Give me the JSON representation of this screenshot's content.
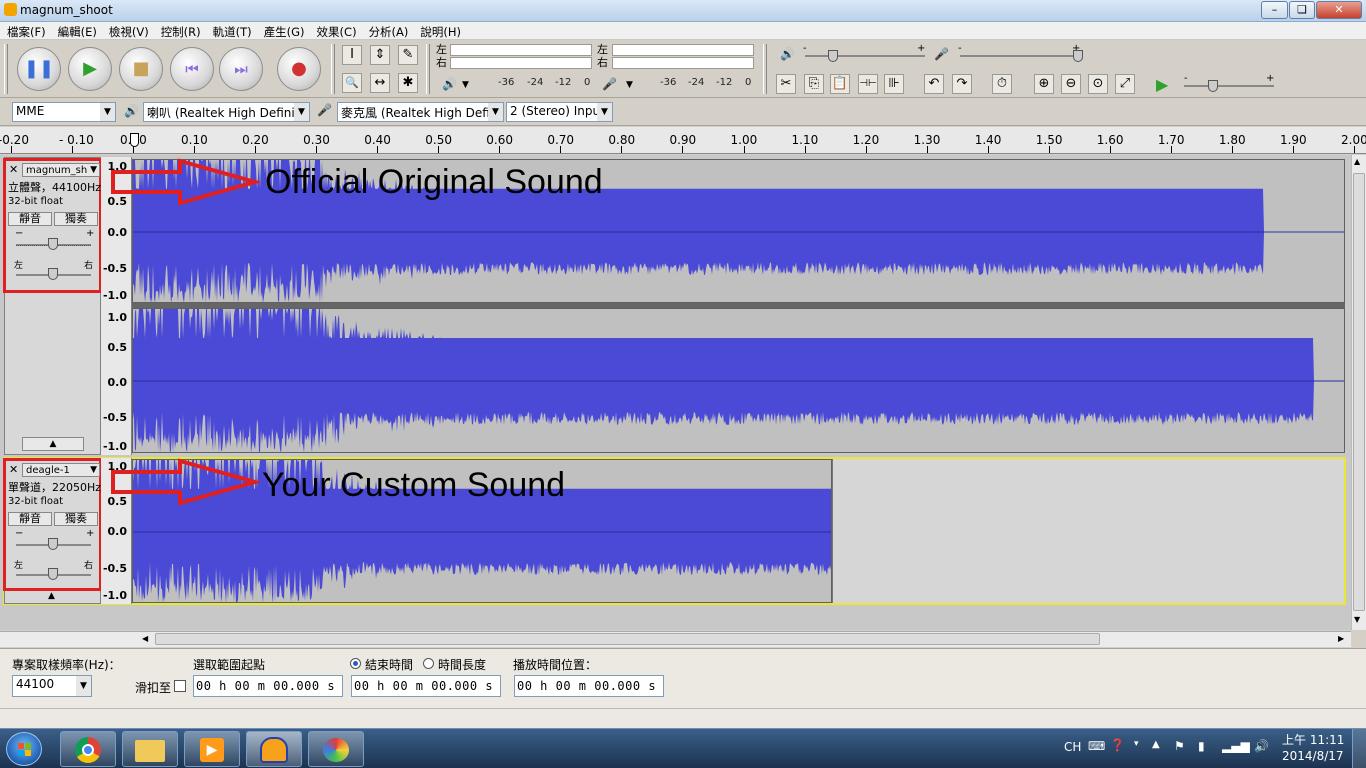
{
  "window": {
    "title": "magnum_shoot",
    "controls": [
      "–",
      "❏",
      "✕"
    ]
  },
  "menu": [
    "檔案(F)",
    "編輯(E)",
    "檢視(V)",
    "控制(R)",
    "軌道(T)",
    "產生(G)",
    "效果(C)",
    "分析(A)",
    "說明(H)"
  ],
  "transport": {
    "pause": "❚❚",
    "play": "▶",
    "stop": "■",
    "skip_start": "⏮",
    "skip_end": "⏭",
    "record": "●"
  },
  "tools": {
    "select": "I",
    "envelope": "⇕",
    "draw": "✎",
    "zoom": "🔍",
    "timeshift": "↔",
    "multi": "✱"
  },
  "meters": {
    "play_label": "左\n右",
    "rec_label": "左\n右",
    "scale": [
      "-36",
      "-24",
      "-12",
      "0"
    ],
    "speaker_icon": "🔊",
    "mic_icon": "🎤"
  },
  "edit_tools": [
    "✂",
    "⎘",
    "📋",
    "⊣⊢",
    "⊪"
  ],
  "mixer": {
    "minus": "-",
    "plus": "+"
  },
  "device": {
    "host": "MME",
    "output": "喇叭 (Realtek High Definitic",
    "input": "麥克風 (Realtek High Defin",
    "channels": "2 (Stereo) Inpu"
  },
  "ruler": [
    "-0.20",
    "- 0.10",
    "0.00",
    "0.10",
    "0.20",
    "0.30",
    "0.40",
    "0.50",
    "0.60",
    "0.70",
    "0.80",
    "0.90",
    "1.00",
    "1.10",
    "1.20",
    "1.30",
    "1.40",
    "1.50",
    "1.60",
    "1.70",
    "1.80",
    "1.90",
    "2.00"
  ],
  "tracks": [
    {
      "name": "magnum_sh",
      "info": "立體聲，44100Hz",
      "format": "32-bit float",
      "mute": "靜音",
      "solo": "獨奏",
      "gain_minus": "−",
      "gain_plus": "+",
      "pan_left": "左",
      "pan_right": "右",
      "y_labels": [
        "1.0",
        "0.5",
        "0.0",
        "-0.5",
        "-1.0"
      ],
      "annotation": "Official Original Sound"
    },
    {
      "name": "deagle-1",
      "info": "單聲道，22050Hz",
      "format": "32-bit float",
      "mute": "靜音",
      "solo": "獨奏",
      "gain_minus": "−",
      "gain_plus": "+",
      "pan_left": "左",
      "pan_right": "右",
      "y_labels": [
        "1.0",
        "0.5",
        "0.0",
        "-0.5",
        "-1.0"
      ],
      "annotation": "Your Custom Sound"
    }
  ],
  "status": {
    "rate_label": "專案取樣頻率(Hz)：",
    "rate_value": "44100",
    "snap_label": "滑扣至",
    "sel_start_label": "選取範圍起點",
    "end_label": "結束時間",
    "length_label": "時間長度",
    "play_pos_label": "播放時間位置：",
    "time1": "00 h 00 m 00.000 s",
    "time2": "00 h 00 m 00.000 s",
    "time3": "00 h 00 m 00.000 s"
  },
  "taskbar": {
    "lang": "CH",
    "time": "上午 11:11",
    "date": "2014/8/17"
  }
}
